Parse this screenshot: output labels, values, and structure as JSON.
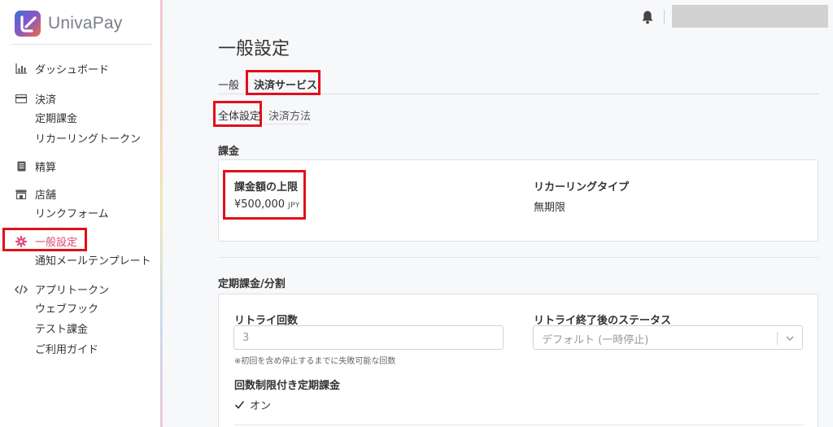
{
  "brand": {
    "name": "UnivaPay"
  },
  "sidebar": {
    "groups": [
      {
        "label": "ダッシュボード",
        "icon": "chart-icon",
        "items": []
      },
      {
        "label": "決済",
        "icon": "credit-card-icon",
        "items": [
          "定期課金",
          "リカーリングトークン"
        ]
      },
      {
        "label": "精算",
        "icon": "document-icon",
        "items": []
      },
      {
        "label": "店舗",
        "icon": "store-icon",
        "items": [
          "リンクフォーム"
        ]
      },
      {
        "label": "一般設定",
        "icon": "gear-icon",
        "items": [
          "通知メールテンプレート"
        ],
        "active": true
      },
      {
        "label": "アプリトークン",
        "icon": "code-icon",
        "items": [
          "ウェブフック",
          "テスト課金",
          "ご利用ガイド"
        ]
      }
    ]
  },
  "page": {
    "title": "一般設定",
    "tabs": [
      "一般",
      "決済サービス"
    ],
    "subtabs": [
      "全体設定",
      "決済方法"
    ]
  },
  "billing": {
    "section_title": "課金",
    "limit_label": "課金額の上限",
    "limit_value": "¥500,000",
    "limit_unit": "JPY",
    "recurring_type_label": "リカーリングタイプ",
    "recurring_type_value": "無期限"
  },
  "subscription": {
    "section_title": "定期課金/分割",
    "retry_count_label": "リトライ回数",
    "retry_count_value": "3",
    "retry_help": "※初回を含め停止するまでに失敗可能な回数",
    "retry_status_label": "リトライ終了後のステータス",
    "retry_status_value": "デフォルト (一時停止)",
    "limited_label": "回数制限付き定期課金",
    "limited_value": "オン"
  },
  "colors": {
    "accent": "#e0487c",
    "highlight": "#e0101a"
  }
}
